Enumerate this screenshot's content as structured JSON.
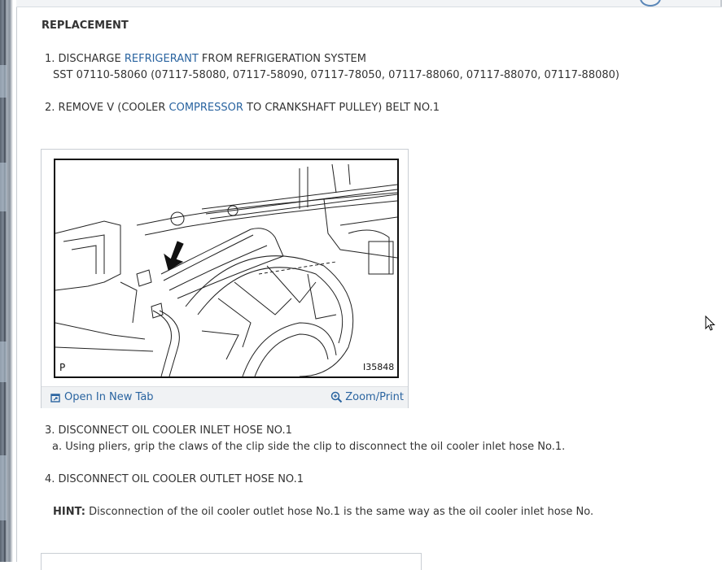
{
  "page": {
    "heading": "REPLACEMENT",
    "steps": [
      {
        "number": "1.",
        "pre": "DISCHARGE ",
        "link": "REFRIGERANT",
        "post": " FROM REFRIGERATION SYSTEM"
      },
      {
        "number": "2.",
        "pre": "REMOVE V (COOLER ",
        "link": "COMPRESSOR",
        "post": " TO CRANKSHAFT PULLEY) BELT NO.1"
      },
      {
        "number": "3.",
        "text": "DISCONNECT OIL COOLER INLET HOSE NO.1"
      },
      {
        "number": "4.",
        "text": "DISCONNECT OIL COOLER OUTLET HOSE NO.1"
      }
    ],
    "sst_line": "SST 07110-58060 (07117-58080, 07117-58090, 07117-78050, 07117-88060, 07117-88070, 07117-88080)",
    "step3_sub": "a. Using pliers, grip the claws of the clip side the clip to disconnect the oil cooler inlet hose No.1.",
    "hint_label": "HINT:",
    "hint_text": " Disconnection of the oil cooler outlet hose No.1 is the same way as the oil cooler inlet hose No."
  },
  "figure": {
    "image_id": "I35848",
    "corner_label": "P",
    "open_label": "Open In New Tab",
    "zoom_label": "Zoom/Print",
    "icons": {
      "open": "open-new-tab-icon",
      "zoom": "zoom-magnifier-icon"
    }
  },
  "colors": {
    "link": "#2a64a0",
    "text": "#333333"
  }
}
